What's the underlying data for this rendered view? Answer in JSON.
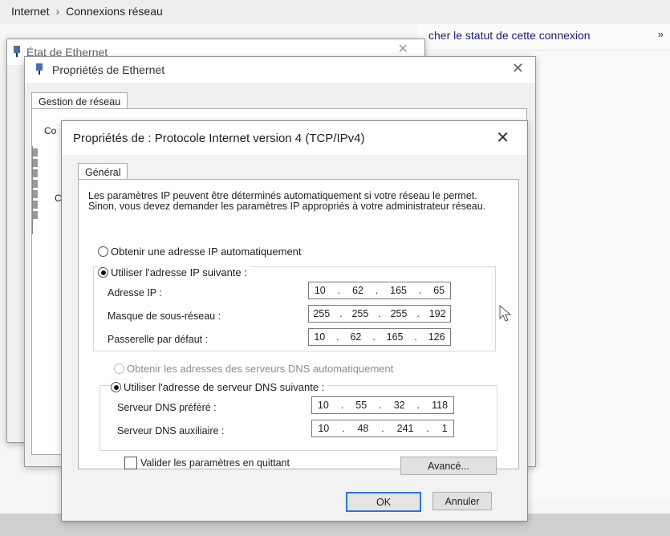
{
  "explorer": {
    "breadcrumb": [
      "Internet",
      "Connexions réseau"
    ],
    "breadcrumb_sep": "›",
    "command_text": "cher le statut de cette connexion",
    "command_more": "»"
  },
  "status_window": {
    "title": "État de Ethernet"
  },
  "ethernet_window": {
    "title": "Propriétés de Ethernet",
    "tab": "Gestion de réseau",
    "clipped_label_1": "Co",
    "clipped_label_2": "Ce"
  },
  "ipv4_dialog": {
    "title": "Propriétés de : Protocole Internet version 4 (TCP/IPv4)",
    "close": "✕",
    "tab": "Général",
    "description": "Les paramètres IP peuvent être déterminés automatiquement si votre réseau le permet. Sinon, vous devez demander les paramètres IP appropriés à votre administrateur réseau.",
    "ip_auto_label": "Obtenir une adresse IP automatiquement",
    "ip_manual_label": "Utiliser l'adresse IP suivante :",
    "ip_address_label": "Adresse IP :",
    "ip_address": [
      "10",
      "62",
      "165",
      "65"
    ],
    "subnet_label": "Masque de sous-réseau :",
    "subnet": [
      "255",
      "255",
      "255",
      "192"
    ],
    "gateway_label": "Passerelle par défaut :",
    "gateway": [
      "10",
      "62",
      "165",
      "126"
    ],
    "dns_auto_label": "Obtenir les adresses des serveurs DNS automatiquement",
    "dns_manual_label": "Utiliser l'adresse de serveur DNS suivante :",
    "dns_preferred_label": "Serveur DNS préféré :",
    "dns_preferred": [
      "10",
      "55",
      "32",
      "118"
    ],
    "dns_alternate_label": "Serveur DNS auxiliaire :",
    "dns_alternate": [
      "10",
      "48",
      "241",
      "1"
    ],
    "validate_label": "Valider les paramètres en quittant",
    "advanced_button": "Avancé...",
    "ok_button": "OK",
    "cancel_button": "Annuler",
    "selected_ip_mode": "manual",
    "selected_dns_mode": "manual",
    "validate_checked": false
  },
  "colors": {
    "primary_button_border": "#2e74d6",
    "link_text": "#1d1d6e"
  }
}
